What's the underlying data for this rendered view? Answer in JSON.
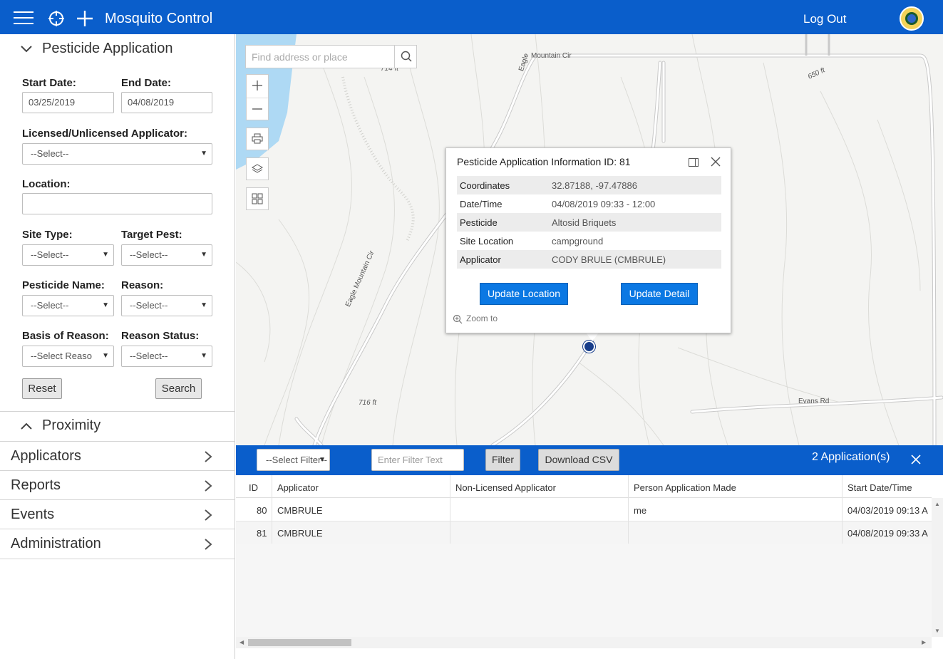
{
  "header": {
    "title": "Mosquito Control",
    "logout_label": "Log Out",
    "bg_color": "#0a5ecb"
  },
  "sidebar": {
    "pesticide_section": "Pesticide Application",
    "start_date_label": "Start Date:",
    "start_date_value": "03/25/2019",
    "end_date_label": "End Date:",
    "end_date_value": "04/08/2019",
    "applicator_label": "Licensed/Unlicensed Applicator:",
    "applicator_value": "--Select--",
    "location_label": "Location:",
    "location_value": "",
    "site_type_label": "Site Type:",
    "site_type_value": "--Select--",
    "target_pest_label": "Target Pest:",
    "target_pest_value": "--Select--",
    "pesticide_name_label": "Pesticide Name:",
    "pesticide_name_value": "--Select--",
    "reason_label": "Reason:",
    "reason_value": "--Select--",
    "basis_label": "Basis of Reason:",
    "basis_value": "--Select Reaso",
    "reason_status_label": "Reason Status:",
    "reason_status_value": "--Select--",
    "reset_label": "Reset",
    "search_label": "Search",
    "proximity_section": "Proximity",
    "nav": [
      "Applicators",
      "Reports",
      "Events",
      "Administration"
    ]
  },
  "map": {
    "search_placeholder": "Find address or place",
    "labels": {
      "mountain_cir": "Mountain Cir",
      "eagle_top": "Eagle",
      "eagle_mountain_cir": "Eagle Mountain Cir",
      "elev_714": "714 ft",
      "elev_650": "650 ft",
      "elev_716": "716 ft",
      "evans_rd": "Evans Rd"
    },
    "water_color": "#aed9f4",
    "marker_color": "#173d8a"
  },
  "popup": {
    "title": "Pesticide Application Information ID: 81",
    "rows": [
      {
        "k": "Coordinates",
        "v": "32.87188, -97.47886"
      },
      {
        "k": "Date/Time",
        "v": "04/08/2019 09:33 - 12:00"
      },
      {
        "k": "Pesticide",
        "v": "Altosid Briquets"
      },
      {
        "k": "Site Location",
        "v": "campground"
      },
      {
        "k": "Applicator",
        "v": "CODY BRULE (CMBRULE)"
      }
    ],
    "update_location_label": "Update Location",
    "update_detail_label": "Update Detail",
    "zoom_to_label": "Zoom to",
    "button_color": "#0b78e3"
  },
  "table_bar": {
    "filter_select_value": "--Select Filter--",
    "filter_input_placeholder": "Enter Filter Text",
    "filter_label": "Filter",
    "download_label": "Download CSV",
    "count_label": "2 Application(s)"
  },
  "grid": {
    "columns": [
      "ID",
      "Applicator",
      "Non-Licensed Applicator",
      "Person Application Made",
      "Start Date/Time"
    ],
    "rows": [
      [
        "80",
        "CMBRULE",
        "",
        "me",
        "04/03/2019 09:13 A"
      ],
      [
        "81",
        "CMBRULE",
        "",
        "",
        "04/08/2019 09:33 A"
      ]
    ]
  }
}
